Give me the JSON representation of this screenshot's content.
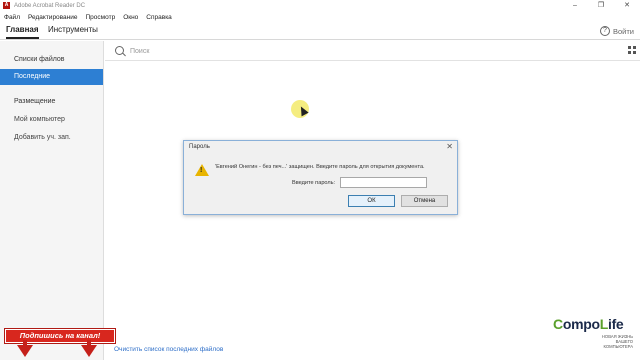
{
  "window": {
    "title": "Adobe Acrobat Reader DC",
    "app_icon_glyph": "A",
    "controls": [
      "–",
      "❐",
      "✕"
    ]
  },
  "menu": [
    "Файл",
    "Редактирование",
    "Просмотр",
    "Окно",
    "Справка"
  ],
  "tabs": {
    "home": "Главная",
    "tools": "Инструменты"
  },
  "header": {
    "help_icon": "?",
    "signin": "Войти"
  },
  "search": {
    "placeholder": "Поиск"
  },
  "sidebar": {
    "files_heading": "Списки файлов",
    "recent": "Последние",
    "storage_heading": "Размещение",
    "my_computer": "Мой компьютер",
    "add_account": "Добавить уч. зап."
  },
  "clear_recent": "Очистить список последних файлов",
  "dialog": {
    "title": "Пароль",
    "close": "✕",
    "warning_mark": "!",
    "message": "'Евгений Онегин - без печ...' защищен. Введите пароль для открытия документа.",
    "password_label": "Введите пароль:",
    "password_value": "",
    "ok": "ОК",
    "cancel": "Отмена"
  },
  "overlay": {
    "subscribe": "Подпишись на канал!",
    "logo_c": "C",
    "logo_ompo": "ompo",
    "logo_l": "L",
    "logo_ife": "ife",
    "logo_tagline_1": "НОВАЯ ЖИЗНЬ",
    "logo_tagline_2": "ВАШЕГО КОМПЬЮТЕРА"
  },
  "colors": {
    "accent": "#2d7fd3",
    "banner_red": "#d8271e",
    "cursor_highlight": "#f3ea6a",
    "warning": "#e8b400"
  },
  "icons": [
    "app-icon",
    "help-icon",
    "search-icon",
    "grid-view-icon",
    "warning-icon",
    "cursor-icon"
  ]
}
